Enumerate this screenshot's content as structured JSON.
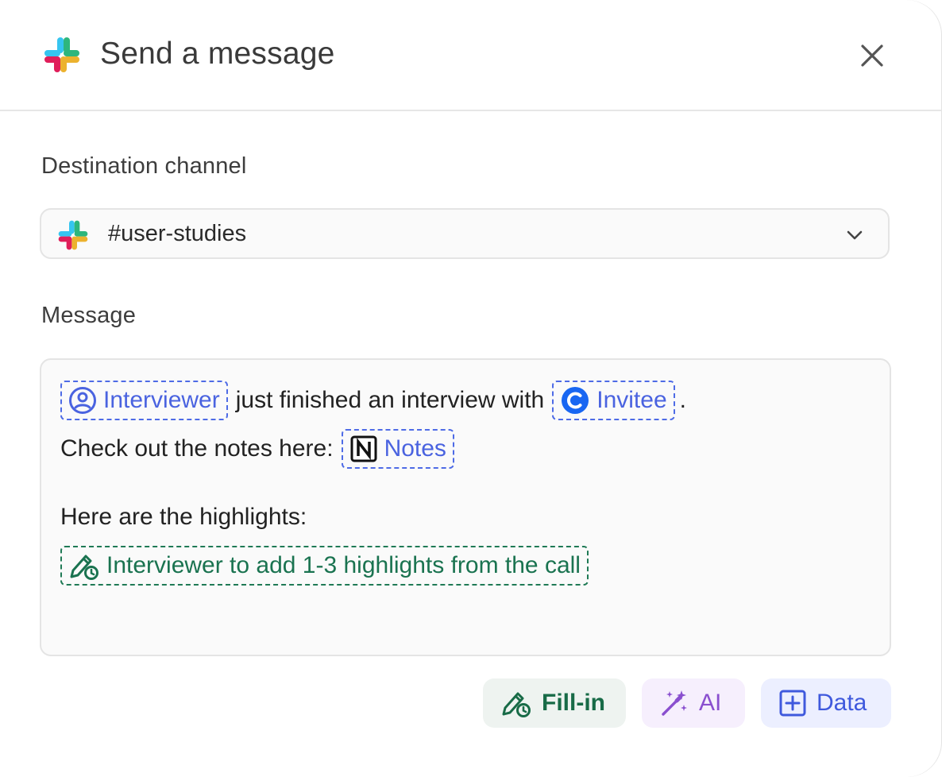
{
  "header": {
    "title": "Send a message",
    "logo_icon": "slack-logo-icon",
    "close_icon": "close-icon"
  },
  "channel": {
    "label": "Destination channel",
    "value": "#user-studies",
    "icon": "slack-logo-icon"
  },
  "message": {
    "label": "Message",
    "line1": {
      "chip1": "Interviewer",
      "text": "just finished an interview with",
      "chip2": "Invitee",
      "end": "."
    },
    "line2": {
      "text": "Check out the notes here:",
      "chip": "Notes"
    },
    "line3": {
      "text": "Here are the highlights:"
    },
    "line4": {
      "chip": "Interviewer to add 1-3 highlights from the call"
    }
  },
  "actions": {
    "fill_in": "Fill-in",
    "ai": "AI",
    "data": "Data"
  },
  "colors": {
    "accent_blue": "#4a63e0",
    "accent_green": "#1a7350",
    "accent_purple": "#8a4fcf"
  }
}
